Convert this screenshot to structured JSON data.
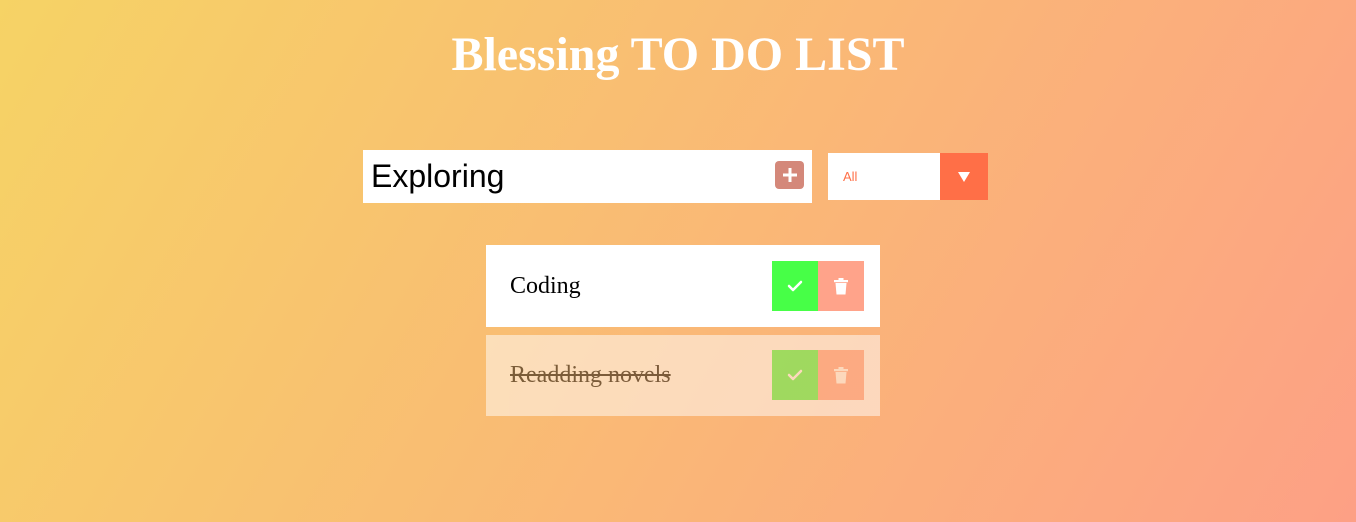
{
  "header": {
    "title": "Blessing TO DO LIST"
  },
  "form": {
    "input_value": "Exploring",
    "add_icon": "plus-icon",
    "filter_selected": "All",
    "filter_arrow_icon": "caret-down-icon"
  },
  "todos": [
    {
      "text": "Coding",
      "completed": false,
      "check_icon": "check-icon",
      "trash_icon": "trash-icon"
    },
    {
      "text": "Readding novels",
      "completed": true,
      "check_icon": "check-icon",
      "trash_icon": "trash-icon"
    }
  ],
  "colors": {
    "gradient_start": "#f6d365",
    "gradient_end": "#fda085",
    "accent": "#ff6f47",
    "complete_green": "#47ff47",
    "trash_salmon": "#ffa38a",
    "add_button": "#d4887a"
  }
}
